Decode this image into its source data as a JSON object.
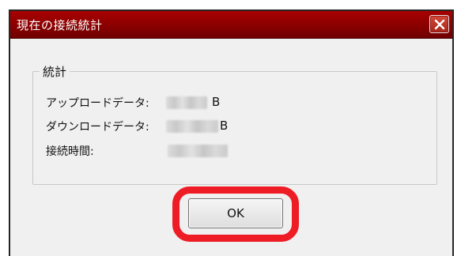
{
  "dialog": {
    "title": "現在の接続統計",
    "close_icon": "close-icon",
    "title_bar_color": "#8a0000"
  },
  "statistics": {
    "group_label": "統計",
    "upload_label": "アップロードデータ:",
    "upload_unit": "B",
    "download_label": "ダウンロードデータ:",
    "download_unit": "B",
    "connection_time_label": "接続時間:"
  },
  "buttons": {
    "ok_label": "OK",
    "highlight_color": "#ee1c25"
  }
}
